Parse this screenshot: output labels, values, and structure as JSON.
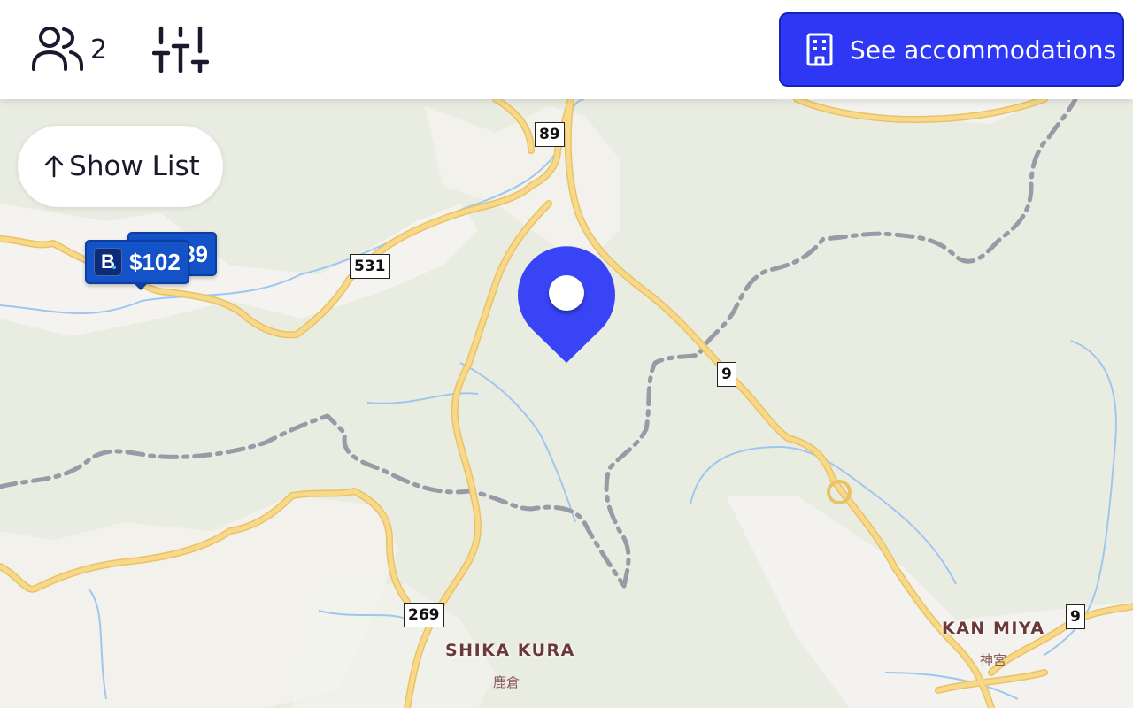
{
  "header": {
    "guest_count": "2",
    "cta_label": "See accommodations"
  },
  "map": {
    "show_list_label": "Show List",
    "price_markers": [
      {
        "label": "$102"
      },
      {
        "label": "89"
      }
    ],
    "route_shields": [
      "89",
      "531",
      "9",
      "269",
      "9"
    ],
    "place_labels": [
      "SHIKA KURA",
      "KAN MIYA"
    ],
    "place_sublabels": [
      "鹿倉",
      "神宮"
    ]
  },
  "colors": {
    "accent": "#2e38f4",
    "price_marker": "#1452c8",
    "land": "#e9ece1",
    "road": "#f5d27a",
    "water": "#9ec7ef",
    "boundary": "#9a9aa6"
  }
}
